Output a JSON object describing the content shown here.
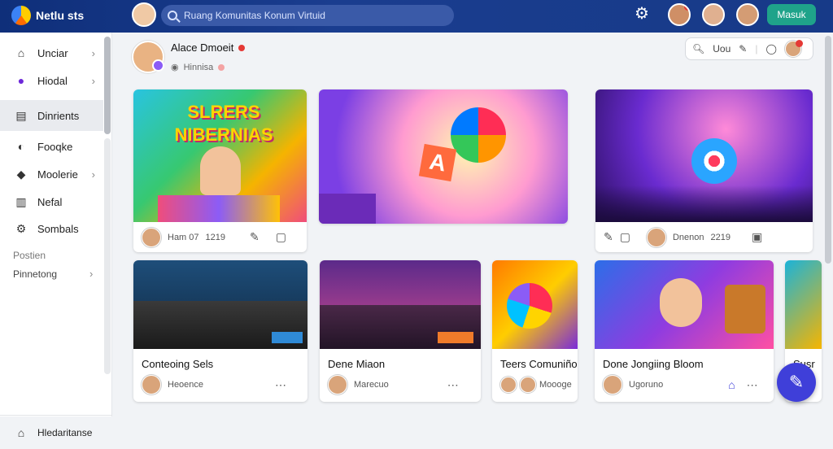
{
  "app": {
    "title": "Netlu sts"
  },
  "search": {
    "placeholder": "Ruang Komunitas Konum Virtuid"
  },
  "header": {
    "join_label": "Masuk"
  },
  "sidebar": {
    "items": [
      {
        "label": "Unciar",
        "icon": "home-icon"
      },
      {
        "label": "Hiodal",
        "icon": "play-icon"
      },
      {
        "label": "Dinrients",
        "icon": "list-icon"
      },
      {
        "label": "Fooqke",
        "icon": "circle-icon"
      },
      {
        "label": "Moolerie",
        "icon": "chat-icon"
      },
      {
        "label": "Nefal",
        "icon": "chart-icon"
      },
      {
        "label": "Sombals",
        "icon": "gear-icon"
      }
    ],
    "section_label": "Postien",
    "section_item": "Pinnetong",
    "bottom_label": "Hledaritanse"
  },
  "profile": {
    "name": "Alace Dmoeit",
    "sub": "Hinnisa"
  },
  "toolbar": {
    "label": "Uou"
  },
  "cards_top": [
    {
      "headline": "SLRERS NIBERNIAS",
      "author": "Ham 07",
      "meta": "1219"
    },
    {
      "headline": "",
      "author": "",
      "meta": ""
    },
    {
      "headline": "",
      "author": "Dnenon",
      "meta": "2219"
    }
  ],
  "cards_bottom": [
    {
      "title": "Conteoing Sels",
      "sub": "Heoence"
    },
    {
      "title": "Dene Miaon",
      "sub": "Marecuo"
    },
    {
      "title": "Teers Comuniño",
      "sub": "Moooge"
    },
    {
      "title": "Done Jongiing Bloom",
      "sub": "Ugoruno"
    },
    {
      "title": "Susr",
      "sub": ""
    }
  ],
  "colors": {
    "topbar": "#173a88",
    "accent": "#1fa38a",
    "fab": "#3f3fd9"
  }
}
